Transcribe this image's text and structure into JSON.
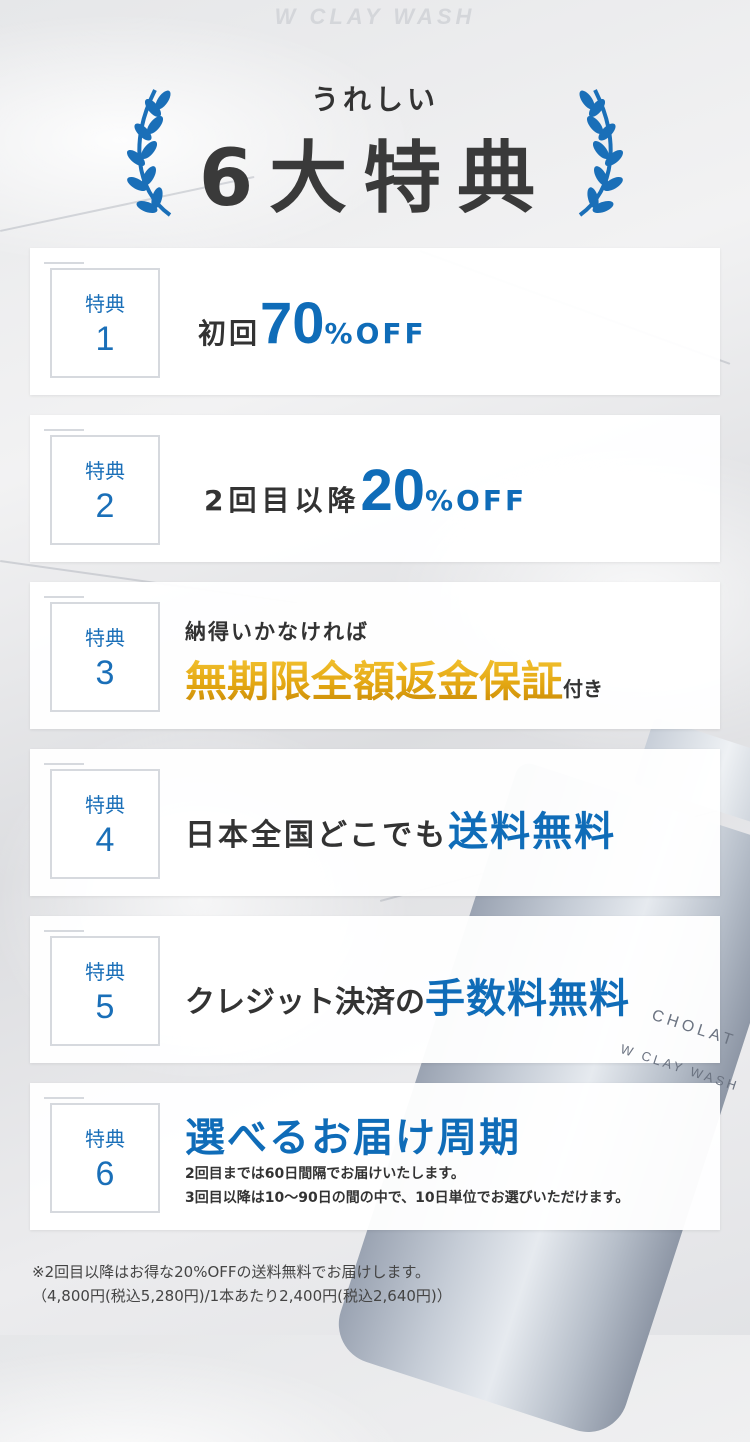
{
  "brand": "W CLAY WASH",
  "hero": {
    "subtitle": "うれしい",
    "title": "6大特典"
  },
  "benefits": [
    {
      "label": "特典",
      "num": "1",
      "pre": "初回",
      "big": "70",
      "suffix": "%OFF"
    },
    {
      "label": "特典",
      "num": "2",
      "pre": "2回目以降",
      "big": "20",
      "suffix": "%OFF"
    },
    {
      "label": "特典",
      "num": "3",
      "top": "納得いかなければ",
      "highlight": "無期限全額返金保証",
      "tail": "付き"
    },
    {
      "label": "特典",
      "num": "4",
      "pre": "日本全国どこでも",
      "highlight": "送料無料"
    },
    {
      "label": "特典",
      "num": "5",
      "pre": "クレジット決済の",
      "highlight": "手数料無料"
    },
    {
      "label": "特典",
      "num": "6",
      "highlight": "選べるお届け周期",
      "detail1": "2回目までは60日間隔でお届けいたします。",
      "detail2": "3回目以降は10〜90日の間の中で、10日単位でお選びいただけます。"
    }
  ],
  "product": {
    "logo": "CHOLAT",
    "name": "W CLAY WASH"
  },
  "footnote": {
    "line1": "※2回目以降はお得な20%OFFの送料無料でお届けします。",
    "line2": "（4,800円(税込5,280円)/1本あたり2,400円(税込2,640円)）"
  },
  "colors": {
    "accent": "#0f6cb8",
    "gold": "#e3a712",
    "text": "#333333"
  }
}
